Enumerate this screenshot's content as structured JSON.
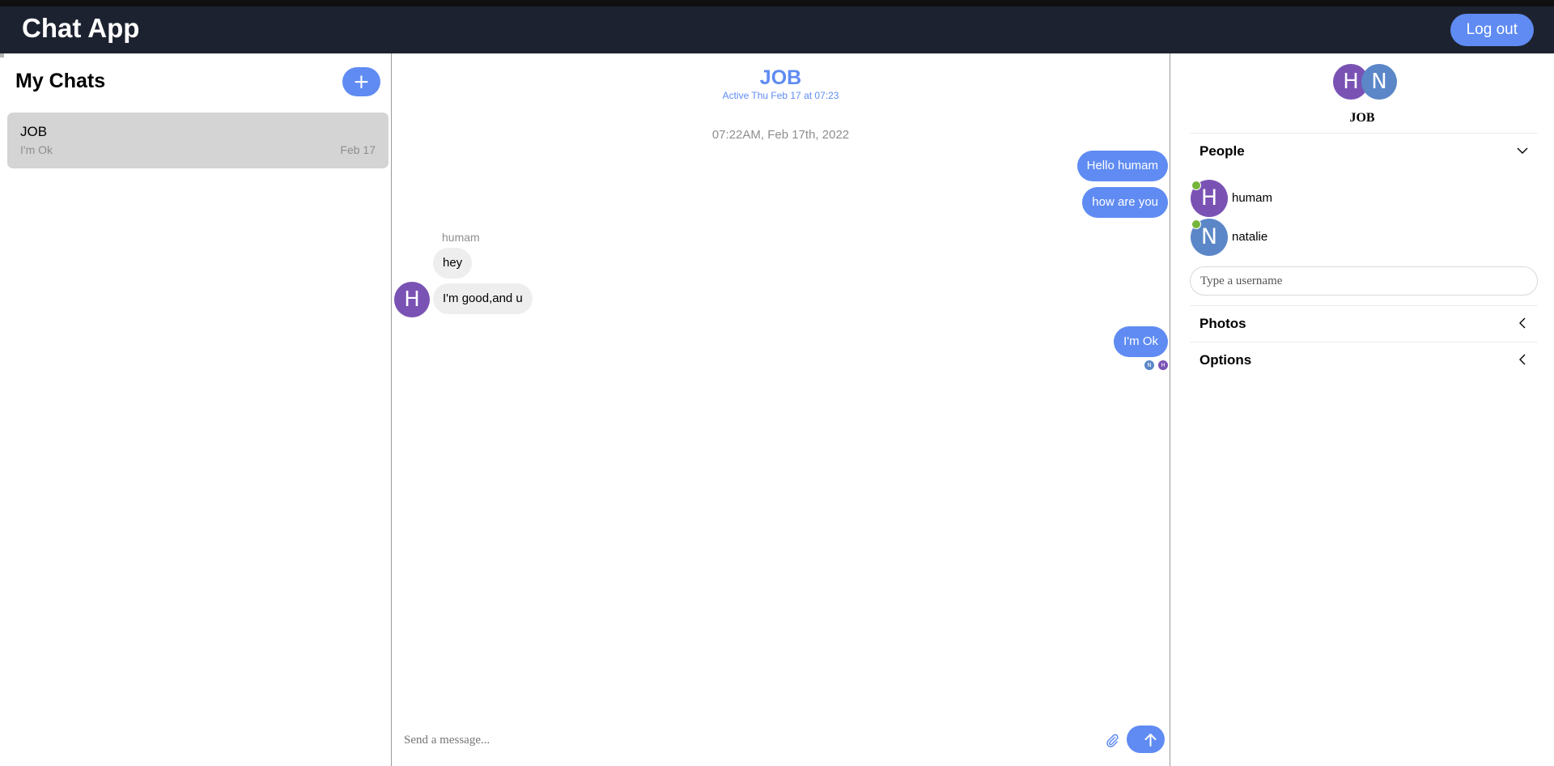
{
  "app": {
    "title": "Chat App",
    "logout_label": "Log out"
  },
  "sidebar": {
    "title": "My Chats",
    "new_chat_label": "+",
    "chats": [
      {
        "name": "JOB",
        "preview": "I'm Ok",
        "date": "Feb 17"
      }
    ]
  },
  "conversation": {
    "title": "JOB",
    "subtitle": "Active Thu Feb 17 at 07:23",
    "timestamp": "07:22AM, Feb 17th, 2022",
    "messages": [
      {
        "text": "Hello humam",
        "direction": "out"
      },
      {
        "text": "how are you",
        "direction": "out"
      },
      {
        "sender": "humam",
        "text": "hey",
        "direction": "in"
      },
      {
        "text": "I'm good,and u",
        "direction": "in",
        "avatar": "H"
      },
      {
        "text": "I'm Ok",
        "direction": "out",
        "read_by": [
          "N",
          "H"
        ]
      }
    ],
    "composer_placeholder": "Send a message..."
  },
  "details": {
    "group_name": "JOB",
    "group_avatars": [
      "H",
      "N"
    ],
    "people_label": "People",
    "people": [
      {
        "initial": "H",
        "name": "humam",
        "online": true
      },
      {
        "initial": "N",
        "name": "natalie",
        "online": true
      }
    ],
    "username_placeholder": "Type a username",
    "photos_label": "Photos",
    "options_label": "Options"
  },
  "colors": {
    "accent": "#5f8bf2",
    "topbar": "#1d2230",
    "avatar_h": "#7a52b4",
    "avatar_n": "#5b87c8",
    "online": "#75b53b"
  }
}
